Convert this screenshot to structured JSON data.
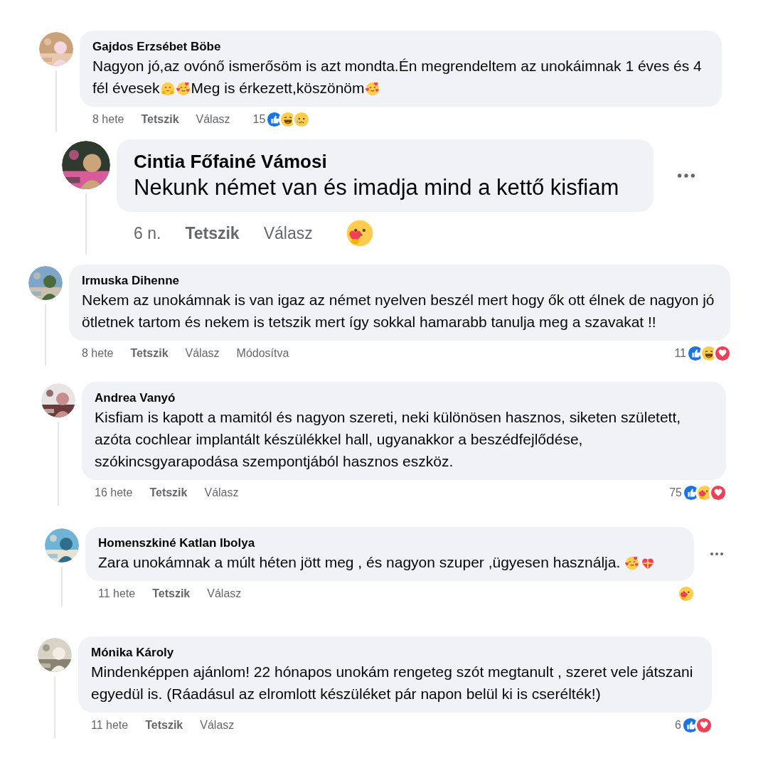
{
  "comments": [
    {
      "author": "Gajdos Erzsébet Böbe",
      "avatar": {
        "kind": "picture"
      },
      "body": [
        {
          "kind": "text",
          "text": "Nagyon jó,az ovónő ismerősöm is azt mondta.Én megrendeltem az unokáimnak 1 éves és 4 fél évesek"
        },
        {
          "kind": "hugface"
        },
        {
          "kind": "hearts"
        },
        {
          "kind": "text",
          "text": "Meg is érkezett,köszönöm"
        },
        {
          "kind": "hearts"
        }
      ],
      "time": "8 hete",
      "like": "Tetszik",
      "reply": "Válasz",
      "reaction_count": "15",
      "reactions": [
        {
          "kind": "like"
        },
        {
          "kind": "haha"
        },
        {
          "kind": "sad"
        }
      ],
      "has_menu": false
    },
    {
      "author": "Cintia Főfainé Vámosi",
      "avatar": {
        "kind": "picture"
      },
      "body": [
        {
          "kind": "text",
          "text": "Nekunk német van és imadja mind a kettő kisfiam"
        }
      ],
      "time": "6 n.",
      "like": "Tetszik",
      "reply": "Válasz",
      "reactions": [
        {
          "kind": "care"
        }
      ],
      "has_menu": true
    },
    {
      "author": "Irmuska Dihenne",
      "avatar": {
        "kind": "picture"
      },
      "body": [
        {
          "kind": "text",
          "text": "Nekem az unokámnak is van igaz az német nyelven beszél mert hogy ők ott élnek de nagyon jó ötletnek tartom és nekem is tetszik mert így sokkal hamarabb tanulja meg a szavakat !!"
        }
      ],
      "time": "8 hete",
      "like": "Tetszik",
      "reply": "Válasz",
      "edited_label": "Módosítva",
      "reaction_count": "11",
      "reactions": [
        {
          "kind": "like"
        },
        {
          "kind": "haha"
        },
        {
          "kind": "love"
        }
      ],
      "has_menu": false
    },
    {
      "author": "Andrea Vanyó",
      "avatar": {
        "kind": "picture"
      },
      "body": [
        {
          "kind": "text",
          "text": "Kisfiam is kapott a mamitól és nagyon szereti, neki különösen hasznos, siketen született, azóta cochlear implantált készülékkel hall, ugyanakkor a beszédfejlődése, szókincsgyarapodása szempontjából hasznos eszköz."
        }
      ],
      "time": "16 hete",
      "like": "Tetszik",
      "reply": "Válasz",
      "reaction_count": "75",
      "reactions": [
        {
          "kind": "like"
        },
        {
          "kind": "care"
        },
        {
          "kind": "love"
        }
      ],
      "has_menu": false
    },
    {
      "author": "Homenszkiné Katlan Ibolya",
      "avatar": {
        "kind": "picture"
      },
      "body": [
        {
          "kind": "text",
          "text": "Zara unokámnak a múlt héten jött meg , és nagyon szuper ,ügyesen használja. "
        },
        {
          "kind": "hearts"
        },
        {
          "kind": "giftheart"
        }
      ],
      "time": "11 hete",
      "like": "Tetszik",
      "reply": "Válasz",
      "reactions": [
        {
          "kind": "care"
        }
      ],
      "has_menu": true
    },
    {
      "author": "Mónika Károly",
      "avatar": {
        "kind": "picture"
      },
      "body": [
        {
          "kind": "text",
          "text": "Mindenképpen ajánlom! 22 hónapos unokám rengeteg szót megtanult , szeret vele játszani egyedül is. (Ráadásul az elromlott készüléket pár napon belül ki is cserélték!)"
        }
      ],
      "time": "11 hete",
      "like": "Tetszik",
      "reply": "Válasz",
      "reaction_count": "6",
      "reactions": [
        {
          "kind": "like"
        },
        {
          "kind": "love"
        }
      ],
      "has_menu": false
    }
  ]
}
